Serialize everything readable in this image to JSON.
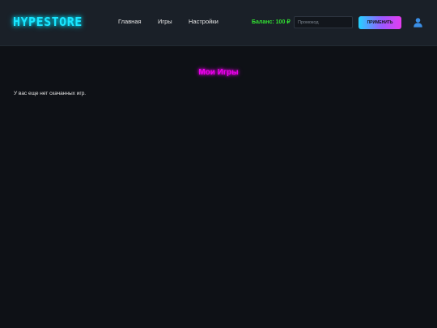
{
  "header": {
    "logo": "HYPESTORE",
    "nav": {
      "home": "Главная",
      "games": "Игры",
      "settings": "Настройки"
    },
    "balance": "Баланс: 100 ₽",
    "promo_placeholder": "Промокод",
    "apply_label": "ПРИМЕНИТЬ",
    "user_icon": "user-icon"
  },
  "main": {
    "title": "Мои Игры",
    "empty_message": "У вас еще нет скачанных игр."
  },
  "colors": {
    "background": "#0e1116",
    "header_bg": "#1a2028",
    "logo": "#19e6ff",
    "balance": "#32e032",
    "title": "#ee00ee",
    "button_gradient_start": "#23d2ff",
    "button_gradient_end": "#e53cf0"
  }
}
